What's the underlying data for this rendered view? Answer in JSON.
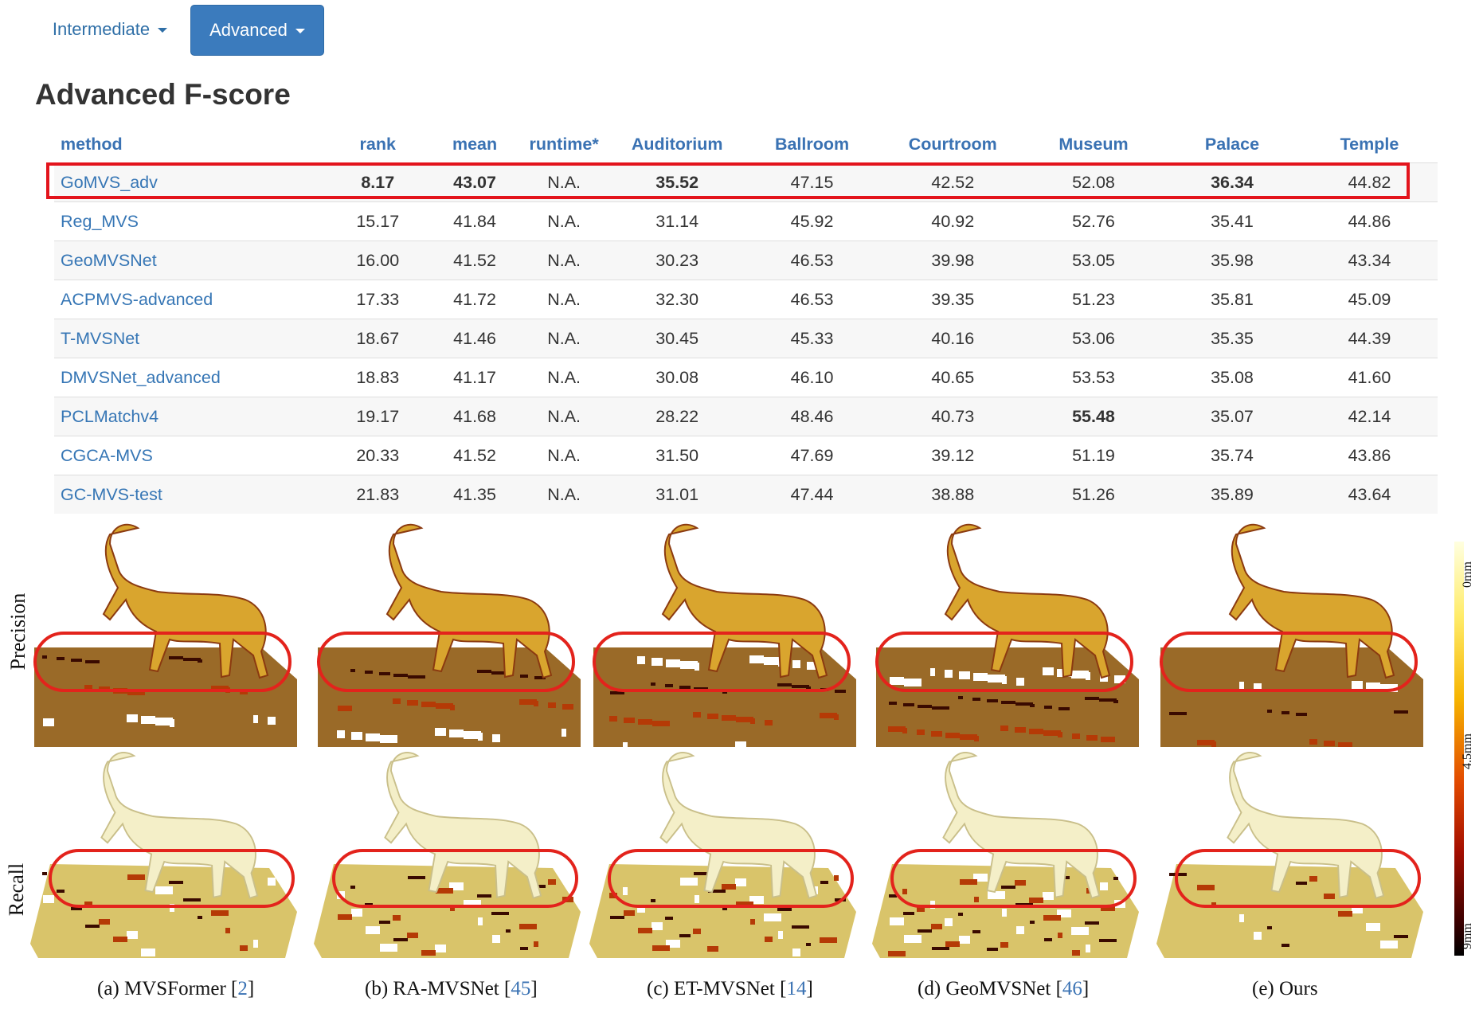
{
  "nav": {
    "intermediate_label": "Intermediate",
    "advanced_label": "Advanced"
  },
  "page_title": "Advanced F-score",
  "table": {
    "columns": [
      "method",
      "rank",
      "mean",
      "runtime*",
      "Auditorium",
      "Ballroom",
      "Courtroom",
      "Museum",
      "Palace",
      "Temple"
    ],
    "rows": [
      [
        "GoMVS_adv",
        "8.17",
        "43.07",
        "N.A.",
        "35.52",
        "47.15",
        "42.52",
        "52.08",
        "36.34",
        "44.82"
      ],
      [
        "Reg_MVS",
        "15.17",
        "41.84",
        "N.A.",
        "31.14",
        "45.92",
        "40.92",
        "52.76",
        "35.41",
        "44.86"
      ],
      [
        "GeoMVSNet",
        "16.00",
        "41.52",
        "N.A.",
        "30.23",
        "46.53",
        "39.98",
        "53.05",
        "35.98",
        "43.34"
      ],
      [
        "ACPMVS-advanced",
        "17.33",
        "41.72",
        "N.A.",
        "32.30",
        "46.53",
        "39.35",
        "51.23",
        "35.81",
        "45.09"
      ],
      [
        "T-MVSNet",
        "18.67",
        "41.46",
        "N.A.",
        "30.45",
        "45.33",
        "40.16",
        "53.06",
        "35.35",
        "44.39"
      ],
      [
        "DMVSNet_advanced",
        "18.83",
        "41.17",
        "N.A.",
        "30.08",
        "46.10",
        "40.65",
        "53.53",
        "35.08",
        "41.60"
      ],
      [
        "PCLMatchv4",
        "19.17",
        "41.68",
        "N.A.",
        "28.22",
        "48.46",
        "40.73",
        "55.48",
        "35.07",
        "42.14"
      ],
      [
        "CGCA-MVS",
        "20.33",
        "41.52",
        "N.A.",
        "31.50",
        "47.69",
        "39.12",
        "51.19",
        "35.74",
        "43.86"
      ],
      [
        "GC-MVS-test",
        "21.83",
        "41.35",
        "N.A.",
        "31.01",
        "47.44",
        "38.88",
        "51.26",
        "35.89",
        "43.64"
      ]
    ],
    "bold_cells": [
      [
        0,
        1
      ],
      [
        0,
        2
      ],
      [
        0,
        4
      ],
      [
        0,
        8
      ],
      [
        6,
        7
      ]
    ]
  },
  "figure": {
    "row_labels": [
      "Precision",
      "Recall"
    ],
    "captions": [
      {
        "text": "(a) MVSFormer [",
        "cite": "2",
        "end": "]"
      },
      {
        "text": "(b) RA-MVSNet [",
        "cite": "45",
        "end": "]"
      },
      {
        "text": "(c) ET-MVSNet [",
        "cite": "14",
        "end": "]"
      },
      {
        "text": "(d) GeoMVSNet  [",
        "cite": "46",
        "end": "]"
      },
      {
        "text": "(e) Ours",
        "cite": "",
        "end": ""
      }
    ],
    "colorbar_labels": [
      "0mm",
      "4.5mm",
      "9mm"
    ]
  }
}
